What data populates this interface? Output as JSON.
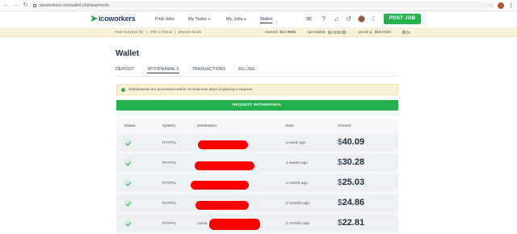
{
  "browser": {
    "url": "picoworkers.com/wallet.php#payments"
  },
  "header": {
    "logo_text": "icoworkers",
    "nav": {
      "find_jobs": "Find Jobs",
      "my_tasks": "My Tasks",
      "my_jobs": "My Jobs",
      "wallet": "Wallet"
    },
    "post_job": "POST JOB"
  },
  "strip": {
    "paid_surveys": "Paid Surveys (0)",
    "sep1": "|",
    "refer": "refer a friend",
    "sep2": "|",
    "deposit": "deposit funds",
    "earned_label": "earned:",
    "earned_value": "$41.9980",
    "spendable_label": "spendable:",
    "spendable_value": "$0.0000",
    "pending_label": "pending:",
    "pending_value": "$10.0430",
    "time_value": "5s"
  },
  "main": {
    "title": "Wallet",
    "tabs": [
      "DEPOSIT",
      "WITHDRAWALS",
      "TRANSACTIONS",
      "BILLING"
    ],
    "notice": "Withdrawals are processed within 10 business days of placing a request",
    "request_button": "REQUEST WITHDRAWAL"
  },
  "table": {
    "headers": {
      "status": "Status",
      "system": "System",
      "destination": "Destination",
      "date": "Date",
      "amount": "Amount"
    },
    "rows": [
      {
        "system": "PAYPAL",
        "destination": "",
        "date": "a week ago",
        "currency": "$",
        "amount": "40.09"
      },
      {
        "system": "PAYPAL",
        "destination": "",
        "date": "4 weeks ago",
        "currency": "$",
        "amount": "30.28"
      },
      {
        "system": "PAYPAL",
        "destination": "",
        "date": "a month ago",
        "currency": "$",
        "amount": "25.03"
      },
      {
        "system": "PAYPAL",
        "destination": "",
        "date": "2 months ago",
        "currency": "$",
        "amount": "24.86"
      },
      {
        "system": "PAYPAL",
        "destination": "cip/sa",
        "date": "2 months ago",
        "currency": "$",
        "amount": "22.81"
      }
    ]
  },
  "colors": {
    "accent_green": "#22b14c",
    "notice_bg": "#fbf1d6",
    "redaction": "#ff0000"
  }
}
